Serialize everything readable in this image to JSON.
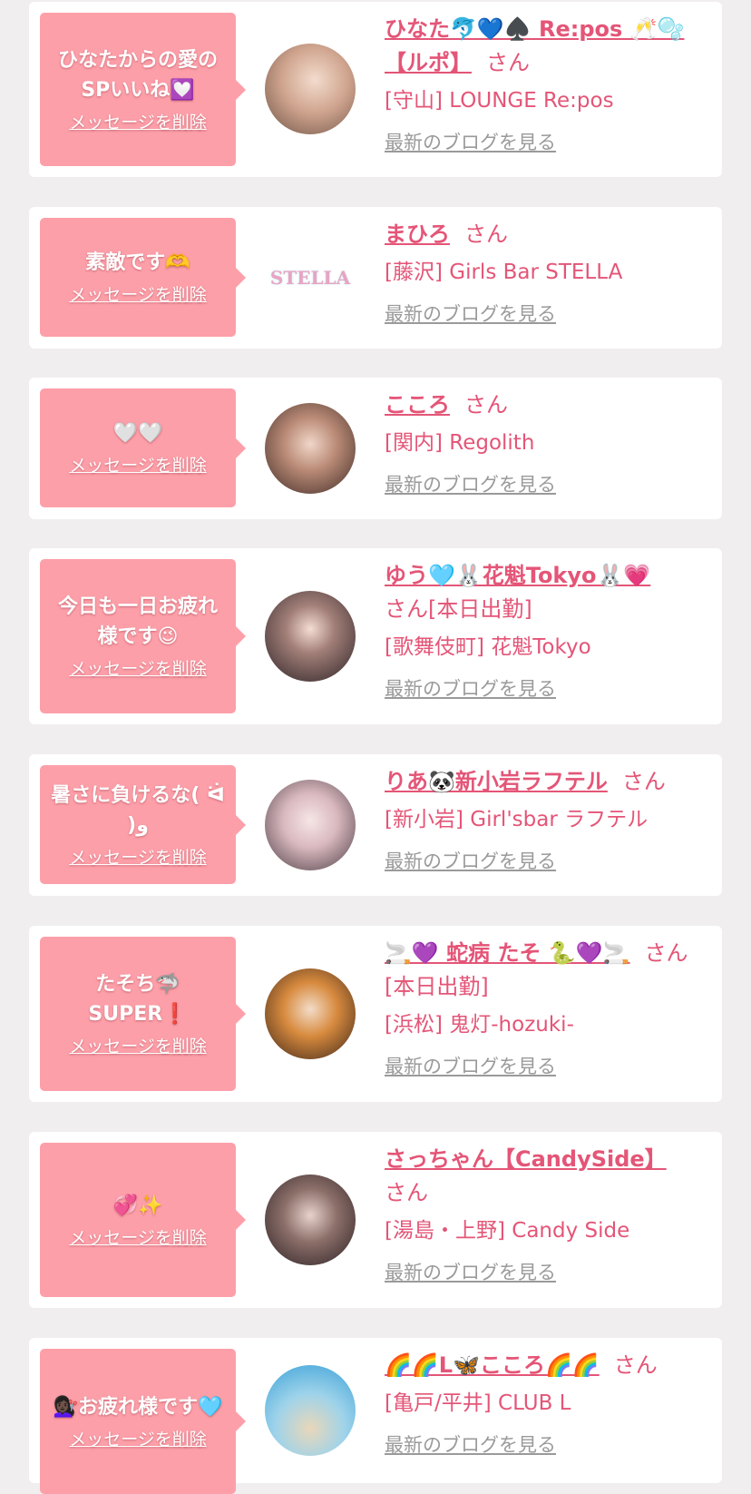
{
  "delete_label": "メッセージを削除",
  "blog_label": "最新のブログを見る",
  "honorific": "さん",
  "colors": {
    "background": "#f1eeef",
    "card": "#ffffff",
    "bubble": "#fd9fa9",
    "accent": "#e45577",
    "muted": "#9a9a9a"
  },
  "cards": [
    {
      "message": "ひなたからの愛のSPいいね💟",
      "name": "ひなた🐬💙♠️ Re:pos 🥂🫧【ルポ】",
      "status": "",
      "shop": "[守山] LOUNGE Re:pos",
      "avatar_icon": "photo-avatar-icon"
    },
    {
      "message": "素敵です🫶",
      "name": "まひろ",
      "status": "",
      "shop": "[藤沢] Girls Bar STELLA",
      "avatar_icon": "stella-logo-icon",
      "avatar_text": "STELLA"
    },
    {
      "message": "🤍🤍",
      "name": "こころ",
      "status": "",
      "shop": "[関内] Regolith",
      "avatar_icon": "photo-avatar-icon"
    },
    {
      "message": "今日も一日お疲れ様です😉",
      "name": "ゆう🩵🐰花魁Tokyo🐰💗",
      "status": "[本日出勤]",
      "shop": "[歌舞伎町] 花魁Tokyo",
      "avatar_icon": "photo-avatar-icon"
    },
    {
      "message": "暑さに負けるな( ᐛ )و",
      "name": "りあ🐼新小岩ラフテル",
      "status": "",
      "shop": "[新小岩] Girl'sbar ラフテル",
      "avatar_icon": "photo-avatar-icon"
    },
    {
      "message": "たそち🦈 SUPER❗️",
      "name": "🚬💜 蛇病 たそ 🐍💜🚬",
      "status": "[本日出勤]",
      "shop": "[浜松] 鬼灯-hozuki-",
      "avatar_icon": "photo-avatar-icon"
    },
    {
      "message": "💞✨",
      "name": "さっちゃん【CandySide】",
      "status": "",
      "shop": "[湯島・上野] Candy Side",
      "avatar_icon": "photo-avatar-icon"
    },
    {
      "message": "💇🏿‍♀️お疲れ様です🩵",
      "name": "🌈🌈L🦋こころ🌈🌈",
      "status": "",
      "shop": "[亀戸/平井] CLUB L",
      "avatar_icon": "photo-avatar-icon"
    }
  ]
}
